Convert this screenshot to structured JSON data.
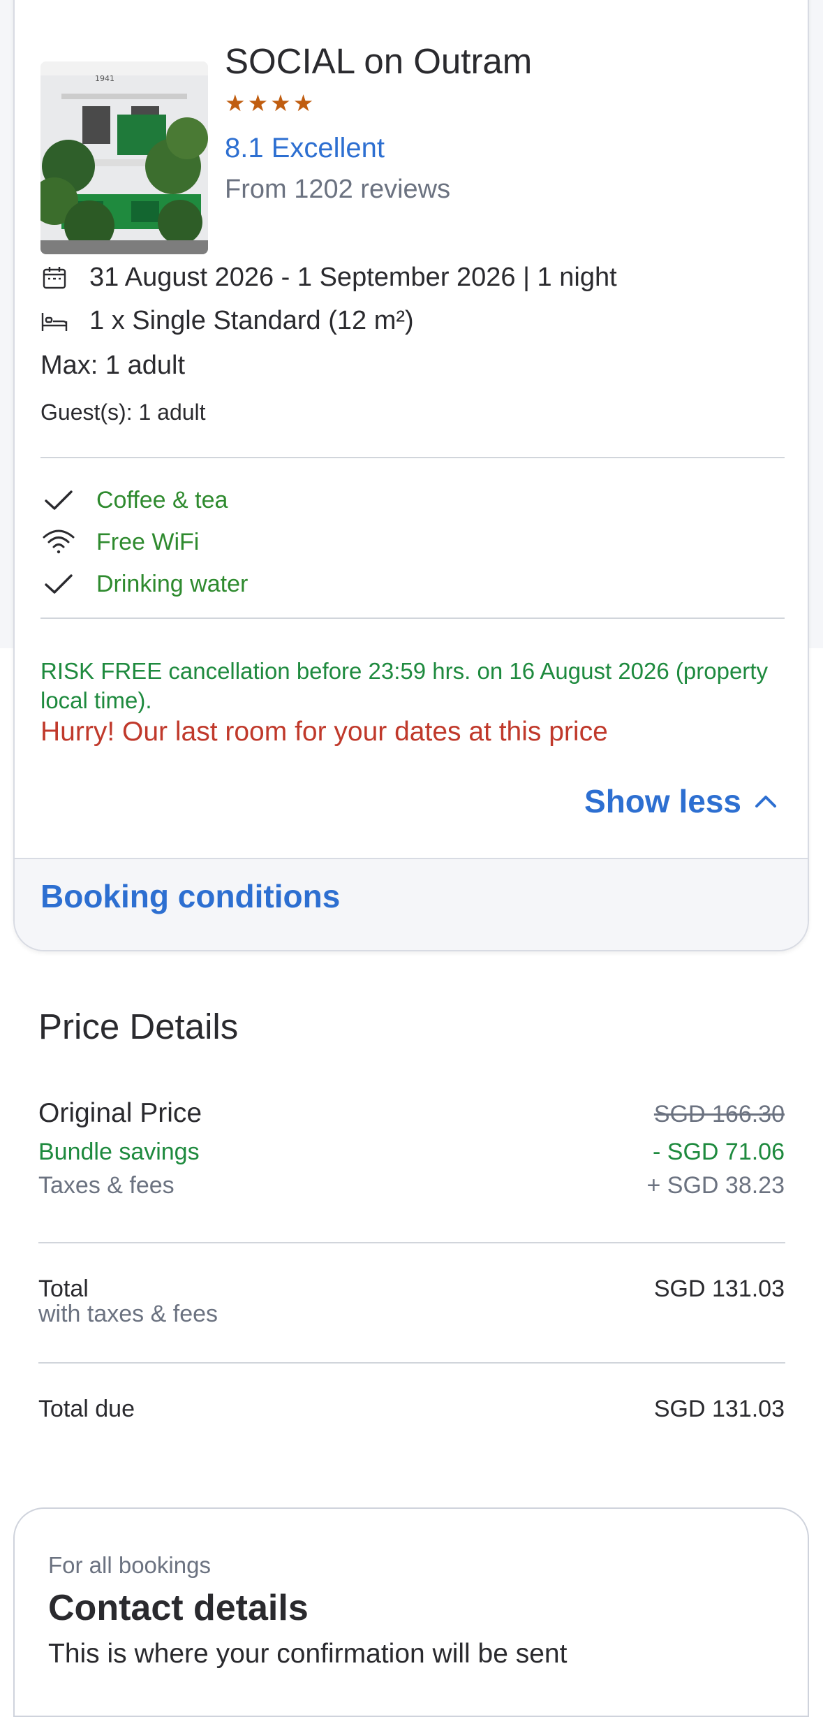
{
  "hotel": {
    "name": "SOCIAL on Outram",
    "stars": "★★★★",
    "star_count": 4,
    "rating": "8.1 Excellent",
    "reviews": "From 1202 reviews",
    "building_sign": "1941"
  },
  "stay": {
    "dates": "31 August 2026 - 1 September 2026 | 1 night",
    "room": "1 x Single Standard (12 m²)",
    "max": "Max: 1 adult",
    "guests": "Guest(s): 1 adult"
  },
  "amenities": [
    "Coffee & tea",
    "Free WiFi",
    "Drinking water"
  ],
  "notices": {
    "cancellation": "RISK FREE cancellation before 23:59 hrs. on 16 August 2026 (property local time).",
    "hurry": "Hurry! Our last room for your dates at this price"
  },
  "actions": {
    "show_less": "Show less",
    "booking_conditions": "Booking conditions"
  },
  "price": {
    "title": "Price Details",
    "original_label": "Original Price",
    "original_value": "SGD 166.30",
    "savings_label": "Bundle savings",
    "savings_value": "- SGD 71.06",
    "taxes_label": "Taxes & fees",
    "taxes_value": "+ SGD 38.23",
    "total_label": "Total",
    "total_sub": "with taxes & fees",
    "total_value": "SGD 131.03",
    "due_label": "Total due",
    "due_value": "SGD 131.03"
  },
  "contact": {
    "eyebrow": "For all bookings",
    "title": "Contact details",
    "subtitle": "This is where your confirmation will be sent"
  },
  "colors": {
    "link": "#2d6fd1",
    "amenity_green": "#2e8a2e",
    "cancel_green": "#1e8a3e",
    "urgent_red": "#c0392b",
    "star": "#c05d10"
  }
}
